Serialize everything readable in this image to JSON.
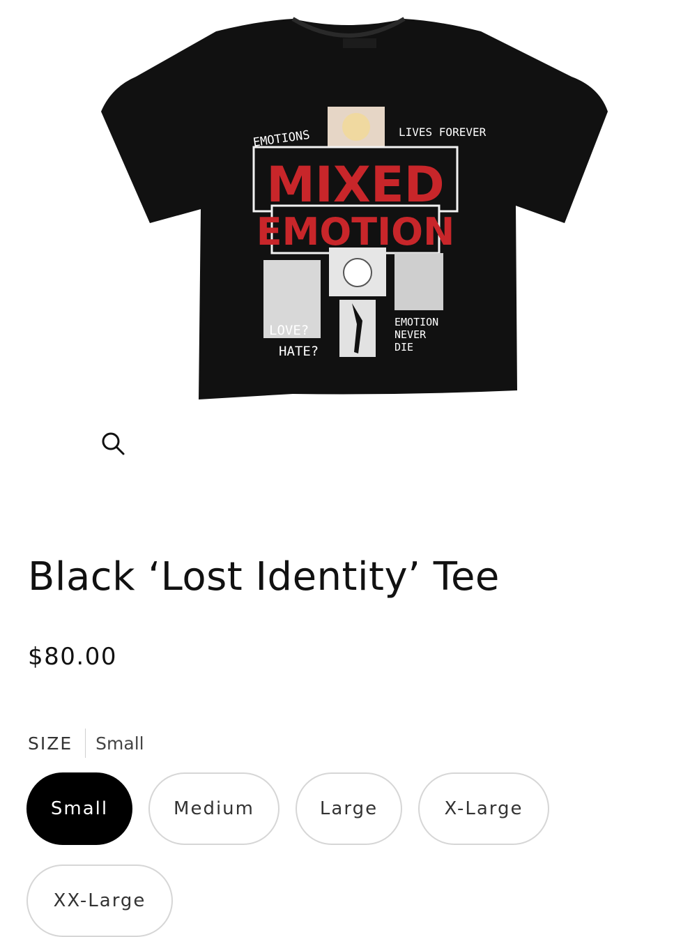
{
  "product": {
    "image": {
      "print_top_left": "EMOTIONS",
      "print_top_right": "LIVES FOREVER",
      "print_title_line1": "MIXED",
      "print_title_line2": "EMOTION",
      "print_bottom_left_line1": "LOVE?",
      "print_bottom_left_line2": "HATE?",
      "print_bottom_right_line1": "EMOTION",
      "print_bottom_right_line2": "NEVER",
      "print_bottom_right_line3": "DIE"
    },
    "title": "Black ‘Lost Identity’ Tee",
    "price": "$80.00",
    "size": {
      "label": "SIZE",
      "selected": "Small",
      "options": [
        "Small",
        "Medium",
        "Large",
        "X-Large",
        "XX-Large"
      ]
    }
  },
  "icons": {
    "zoom": "search-icon"
  },
  "colors": {
    "accent": "#000000",
    "print_red": "#c8262a",
    "shirt": "#111111"
  }
}
